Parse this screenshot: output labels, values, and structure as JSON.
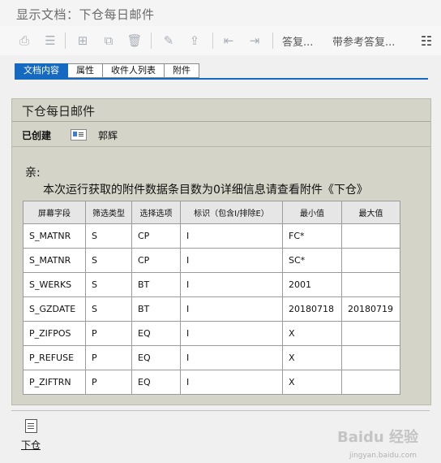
{
  "window": {
    "title": "显示文档：下仓每日邮件"
  },
  "toolbar": {
    "icons": [
      "print-icon",
      "list-icon",
      "hierarchy-icon",
      "tree-icon",
      "delete-icon",
      "edit-icon",
      "export-icon",
      "back-icon",
      "forward-icon"
    ],
    "reply_label": "答复...",
    "reply_ref_label": "带参考答复..."
  },
  "tabs": [
    {
      "label": "文档内容",
      "active": true
    },
    {
      "label": "属性",
      "active": false
    },
    {
      "label": "收件人列表",
      "active": false
    },
    {
      "label": "附件",
      "active": false
    }
  ],
  "document": {
    "subject": "下仓每日邮件",
    "status": "已创建",
    "author": "郭辉",
    "greeting": "亲:",
    "body_text": "本次运行获取的附件数据条目数为0详细信息请查看附件《下仓》"
  },
  "table": {
    "columns": [
      "屏幕字段",
      "筛选类型",
      "选择选项",
      "标识（包含I/排除E）",
      "最小值",
      "最大值"
    ],
    "rows": [
      [
        "S_MATNR",
        "S",
        "CP",
        "I",
        "FC*",
        ""
      ],
      [
        "S_MATNR",
        "S",
        "CP",
        "I",
        "SC*",
        ""
      ],
      [
        "S_WERKS",
        "S",
        "BT",
        "I",
        "2001",
        ""
      ],
      [
        "S_GZDATE",
        "S",
        "BT",
        "I",
        "20180718",
        "20180719"
      ],
      [
        "P_ZIFPOS",
        "P",
        "EQ",
        "I",
        "X",
        ""
      ],
      [
        "P_REFUSE",
        "P",
        "EQ",
        "I",
        "X",
        ""
      ],
      [
        "P_ZIFTRN",
        "P",
        "EQ",
        "I",
        "X",
        ""
      ]
    ]
  },
  "attachment": {
    "label": "下仓"
  },
  "watermark": {
    "brand": "Baidu 经验",
    "url": "jingyan.baidu.com"
  }
}
